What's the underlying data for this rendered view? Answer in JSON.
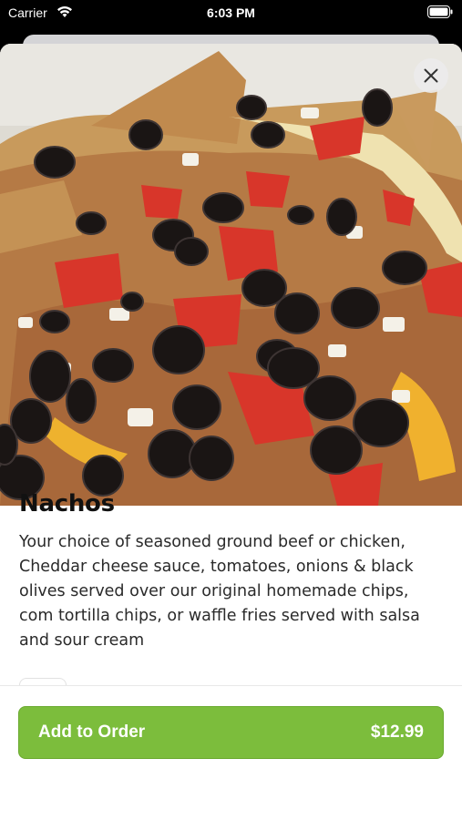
{
  "status_bar": {
    "carrier": "Carrier",
    "time": "6:03 PM"
  },
  "item": {
    "name": "Nachos",
    "description": "Your choice of seasoned ground beef or chicken, Cheddar cheese sauce, tomatoes, onions & black olives served over our original homemade chips, com tortilla chips, or waffle fries served with salsa and sour cream",
    "image": "nachos-photo"
  },
  "footer": {
    "add_label": "Add to Order",
    "price": "$12.99"
  },
  "colors": {
    "accent": "#7cbd3c",
    "text": "#111111"
  },
  "icons": [
    "wifi-icon",
    "battery-icon",
    "close-icon"
  ]
}
